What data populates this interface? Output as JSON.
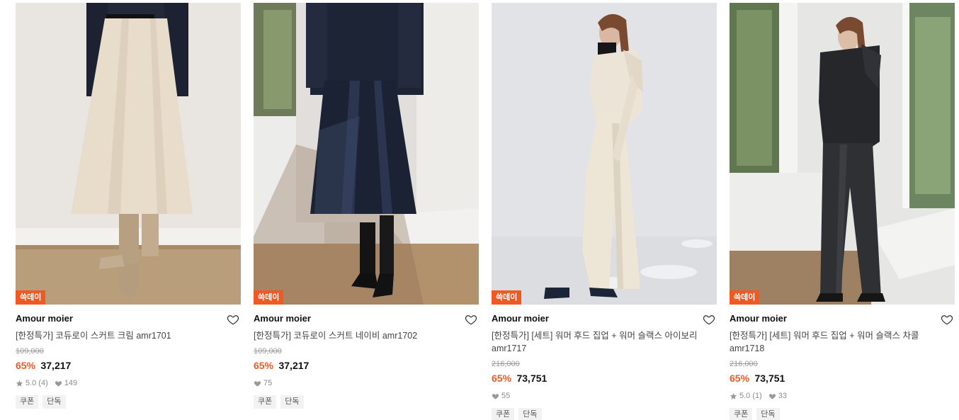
{
  "products": [
    {
      "badge": "쓱데이",
      "brand": "Amour moier",
      "name": "[한정특가] 코듀로이 스커트 크림 amr1701",
      "original_price": "109,000",
      "discount": "65%",
      "price": "37,217",
      "rating": "5.0",
      "review_count": "(4)",
      "likes": "149",
      "tags": [
        "쿠폰",
        "단독"
      ]
    },
    {
      "badge": "쓱데이",
      "brand": "Amour moier",
      "name": "[한정특가] 코듀로이 스커트 네이비 amr1702",
      "original_price": "109,000",
      "discount": "65%",
      "price": "37,217",
      "likes": "75",
      "tags": [
        "쿠폰",
        "단독"
      ]
    },
    {
      "badge": "쓱데이",
      "brand": "Amour moier",
      "name": "[한정특가] [세트] 워머 후드 집업 + 워머 슬랙스 아이보리 amr1717",
      "original_price": "216,000",
      "discount": "65%",
      "price": "73,751",
      "likes": "55",
      "tags": [
        "쿠폰",
        "단독"
      ]
    },
    {
      "badge": "쓱데이",
      "brand": "Amour moier",
      "name": "[한정특가] [세트] 워머 후드 집업 + 워머 슬랙스 차콜 amr1718",
      "original_price": "216,000",
      "discount": "65%",
      "price": "73,751",
      "rating": "5.0",
      "review_count": "(1)",
      "likes": "33",
      "tags": [
        "쿠폰",
        "단독"
      ]
    }
  ],
  "icons": {
    "wishlist": "heart-outline-icon",
    "rating": "star-icon",
    "likes": "heart-filled-icon"
  },
  "colors": {
    "badge": "#f05a22",
    "discount": "#f05a22",
    "tag_bg": "#f2f2f2"
  }
}
